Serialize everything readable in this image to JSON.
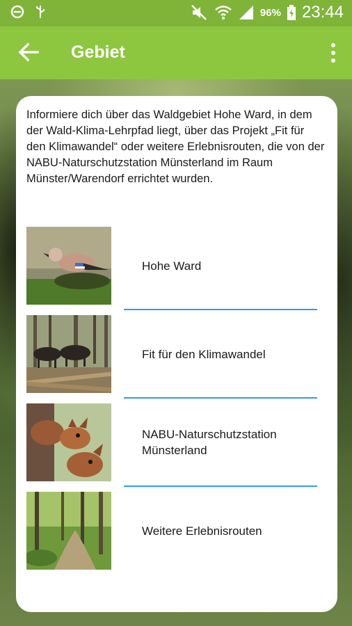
{
  "status_bar": {
    "battery": "96%",
    "time": "23:44",
    "icons": [
      "minus-circle-icon",
      "usb-icon",
      "mute-icon",
      "wifi-icon",
      "signal-icon",
      "battery-icon"
    ]
  },
  "app_bar": {
    "title": "Gebiet",
    "color": "#8dc63f"
  },
  "intro": "Informiere dich über das Waldgebiet Hohe Ward, in dem der Wald-Klima-Lehrpfad liegt, über das Projekt „Fit für den Klimawandel“ oder weitere Erlebnisrouten, die von der NABU-Naturschutzstation Münsterland im Raum Münster/Warendorf errichtet wurden.",
  "items": [
    {
      "label": "Hohe Ward",
      "image": "jay-bird-photo"
    },
    {
      "label": "Fit für den Klimawandel",
      "image": "horses-forest-photo"
    },
    {
      "label": "NABU-Naturschutzstation Münsterland",
      "image": "squirrels-photo"
    },
    {
      "label": "Weitere Erlebnisrouten",
      "image": "forest-path-photo"
    }
  ],
  "divider_color": "#2e9bf2"
}
